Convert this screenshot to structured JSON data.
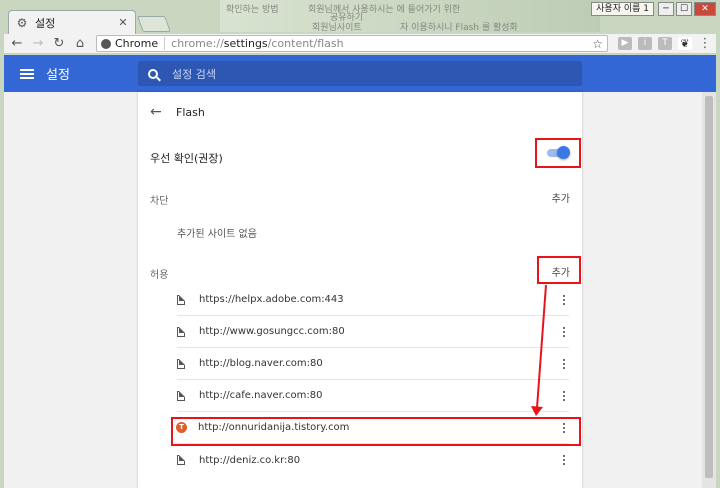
{
  "tab": {
    "title": "설정",
    "close": "✕"
  },
  "window": {
    "user_label": "사용자 이름 1",
    "minimize": "─",
    "maximize": "☐",
    "close": "✕"
  },
  "background": {
    "text1": "확인하는 방법",
    "text2": "회원님께서 사용하시는 에 들어가기 위한",
    "text3": "회원님사이트",
    "text4": "자 이용하시니 Flash 를 활성화",
    "text5": "공유하기"
  },
  "toolbar": {
    "back": "←",
    "forward": "→",
    "reload": "↻",
    "home": "⌂",
    "chip_label": "Chrome",
    "url_prefix": "chrome://",
    "url_host": "settings",
    "url_path": "/content/flash",
    "star": "☆",
    "menu": "⋮"
  },
  "header": {
    "title": "설정",
    "search_placeholder": "설정 검색"
  },
  "page": {
    "back": "←",
    "title": "Flash",
    "ask_first_label": "우선 확인(권장)",
    "ask_first_enabled": true,
    "block": {
      "label": "차단",
      "add": "추가",
      "empty": "추가된 사이트 없음"
    },
    "allow": {
      "label": "허용",
      "add": "추가",
      "sites": [
        {
          "url": "https://helpx.adobe.com:443",
          "icon": "file-icon"
        },
        {
          "url": "http://www.gosungcc.com:80",
          "icon": "file-icon"
        },
        {
          "url": "http://blog.naver.com:80",
          "icon": "file-icon"
        },
        {
          "url": "http://cafe.naver.com:80",
          "icon": "file-icon"
        },
        {
          "url": "http://onnuridanija.tistory.com",
          "icon": "tistory-icon"
        },
        {
          "url": "http://deniz.co.kr:80",
          "icon": "file-icon"
        }
      ]
    }
  },
  "colors": {
    "header": "#3367d6",
    "accent": "#3b78e7",
    "annotation": "#e8141c"
  }
}
